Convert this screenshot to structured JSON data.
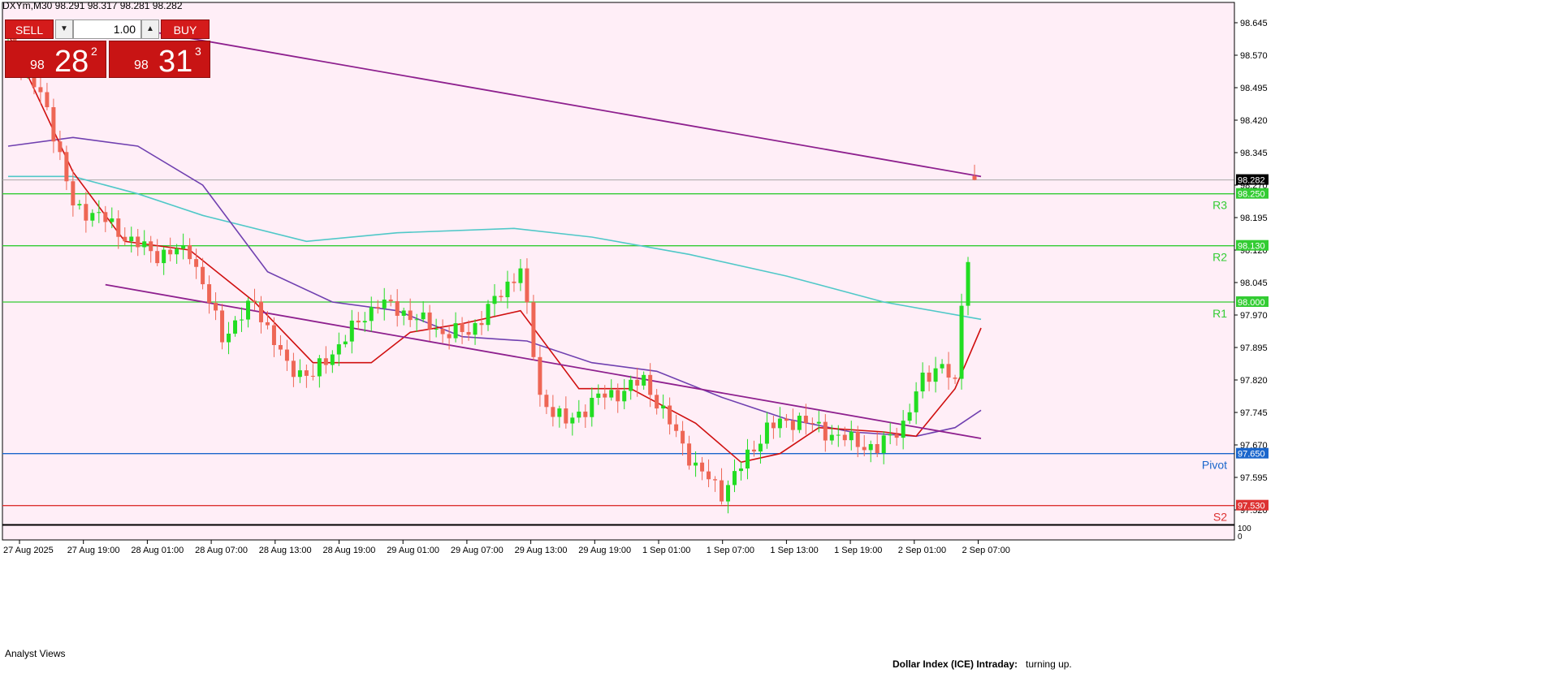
{
  "title": "DXYm,M30  98.291 98.317 98.281 98.282",
  "colors": {
    "background": "#ffeef7",
    "bull": "#22dd22",
    "bear": "#ee6655",
    "ma_red": "#d01010",
    "ma_purple": "#7040b0",
    "ma_teal": "#50c8c8",
    "trendline": "#8e208e",
    "level_green": "#33cc33",
    "pivot_blue": "#1a66cc",
    "s2_red": "#dd3333"
  },
  "trade_panel": {
    "sell_label": "SELL",
    "buy_label": "BUY",
    "volume": "1.00",
    "sell_price": {
      "prefix": "98",
      "big": "28",
      "sup": "2"
    },
    "buy_price": {
      "prefix": "98",
      "big": "31",
      "sup": "3"
    }
  },
  "subwindow_label": "Analyst Views",
  "bottom_note": {
    "bold": "Dollar Index (ICE) Intraday:",
    "text": "turning up."
  },
  "chart_data": {
    "type": "candlestick",
    "symbol": "DXYm",
    "timeframe": "M30",
    "ylim": [
      97.5,
      98.7
    ],
    "yticks": [
      "98.645",
      "98.570",
      "98.495",
      "98.420",
      "98.345",
      "98.270",
      "98.195",
      "98.120",
      "98.045",
      "97.970",
      "97.895",
      "97.820",
      "97.745",
      "97.670",
      "97.595",
      "97.520"
    ],
    "subwindow_ticks": [
      "100",
      "0"
    ],
    "xticks": [
      "27 Aug 2025",
      "27 Aug 19:00",
      "28 Aug 01:00",
      "28 Aug 07:00",
      "28 Aug 13:00",
      "28 Aug 19:00",
      "29 Aug 01:00",
      "29 Aug 07:00",
      "29 Aug 13:00",
      "29 Aug 19:00",
      "1 Sep 01:00",
      "1 Sep 07:00",
      "1 Sep 13:00",
      "1 Sep 19:00",
      "2 Sep 01:00",
      "2 Sep 07:00"
    ],
    "current_price": "98.282",
    "levels": [
      {
        "name": "R3",
        "value": "98.250"
      },
      {
        "name": "R2",
        "value": "98.130"
      },
      {
        "name": "R1",
        "value": "98.000"
      },
      {
        "name": "Pivot",
        "value": "97.650"
      },
      {
        "name": "S2",
        "value": "97.530"
      }
    ],
    "candle_count": 150,
    "candle_close_path": [
      [
        0,
        98.6
      ],
      [
        6,
        98.45
      ],
      [
        10,
        98.22
      ],
      [
        14,
        98.2
      ],
      [
        19,
        98.14
      ],
      [
        23,
        98.11
      ],
      [
        28,
        98.12
      ],
      [
        33,
        97.92
      ],
      [
        38,
        98.0
      ],
      [
        43,
        97.85
      ],
      [
        47,
        97.83
      ],
      [
        52,
        97.92
      ],
      [
        57,
        98.0
      ],
      [
        62,
        97.97
      ],
      [
        67,
        97.93
      ],
      [
        71,
        97.93
      ],
      [
        76,
        98.02
      ],
      [
        79,
        98.08
      ],
      [
        82,
        97.78
      ],
      [
        86,
        97.72
      ],
      [
        91,
        97.78
      ],
      [
        94,
        97.79
      ],
      [
        98,
        97.82
      ],
      [
        102,
        97.72
      ],
      [
        106,
        97.62
      ],
      [
        110,
        97.56
      ],
      [
        113,
        97.62
      ],
      [
        117,
        97.71
      ],
      [
        122,
        97.73
      ],
      [
        126,
        97.7
      ],
      [
        130,
        97.68
      ],
      [
        134,
        97.66
      ],
      [
        138,
        97.72
      ],
      [
        141,
        97.82
      ],
      [
        144,
        97.86
      ],
      [
        146,
        97.8
      ],
      [
        147,
        98.0
      ],
      [
        148,
        98.1
      ],
      [
        149,
        98.282
      ]
    ],
    "ma_fast": [
      [
        0,
        98.62
      ],
      [
        10,
        98.3
      ],
      [
        18,
        98.14
      ],
      [
        28,
        98.12
      ],
      [
        38,
        98.0
      ],
      [
        47,
        97.86
      ],
      [
        56,
        97.86
      ],
      [
        62,
        97.93
      ],
      [
        70,
        97.95
      ],
      [
        79,
        97.98
      ],
      [
        88,
        97.8
      ],
      [
        96,
        97.8
      ],
      [
        106,
        97.72
      ],
      [
        113,
        97.63
      ],
      [
        119,
        97.65
      ],
      [
        125,
        97.71
      ],
      [
        135,
        97.7
      ],
      [
        140,
        97.69
      ],
      [
        146,
        97.8
      ],
      [
        150,
        97.94
      ]
    ],
    "ma_mid": [
      [
        0,
        98.36
      ],
      [
        10,
        98.38
      ],
      [
        20,
        98.36
      ],
      [
        30,
        98.27
      ],
      [
        40,
        98.07
      ],
      [
        50,
        98.0
      ],
      [
        60,
        97.98
      ],
      [
        70,
        97.92
      ],
      [
        80,
        97.91
      ],
      [
        90,
        97.86
      ],
      [
        100,
        97.84
      ],
      [
        110,
        97.78
      ],
      [
        120,
        97.73
      ],
      [
        130,
        97.7
      ],
      [
        140,
        97.69
      ],
      [
        146,
        97.71
      ],
      [
        150,
        97.75
      ]
    ],
    "ma_slow": [
      [
        0,
        98.29
      ],
      [
        10,
        98.29
      ],
      [
        20,
        98.25
      ],
      [
        30,
        98.2
      ],
      [
        46,
        98.14
      ],
      [
        60,
        98.16
      ],
      [
        78,
        98.17
      ],
      [
        90,
        98.15
      ],
      [
        105,
        98.11
      ],
      [
        120,
        98.06
      ],
      [
        135,
        98.0
      ],
      [
        150,
        97.96
      ]
    ],
    "trendlines": [
      {
        "from": [
          20,
          98.63
        ],
        "to": [
          150,
          98.29
        ]
      },
      {
        "from": [
          15,
          98.04
        ],
        "to": [
          150,
          97.685
        ]
      }
    ]
  }
}
